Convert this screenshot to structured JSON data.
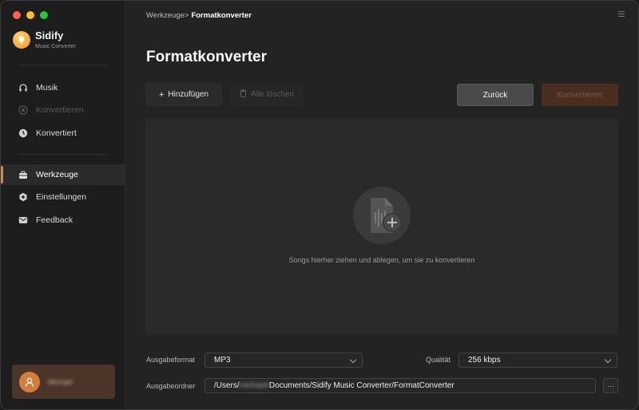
{
  "app": {
    "name": "Sidify",
    "subtitle": "Music Converter"
  },
  "sidebar": {
    "items": [
      {
        "label": "Musik",
        "icon": "headphones-icon",
        "state": "normal"
      },
      {
        "label": "Konvertieren",
        "icon": "convert-icon",
        "state": "disabled"
      },
      {
        "label": "Konvertiert",
        "icon": "clock-icon",
        "state": "normal"
      },
      {
        "label": "Werkzeuge",
        "icon": "toolbox-icon",
        "state": "active"
      },
      {
        "label": "Einstellungen",
        "icon": "gear-icon",
        "state": "normal"
      },
      {
        "label": "Feedback",
        "icon": "mail-icon",
        "state": "normal"
      }
    ],
    "user": {
      "name": "Michael",
      "icon": "user-icon"
    }
  },
  "breadcrumb": {
    "parent": "Werkzeuge",
    "separator": ">",
    "current": "Formatkonverter"
  },
  "page_title": "Formatkonverter",
  "toolbar": {
    "add_label": "Hinzufügen",
    "clear_label": "Alle löschen",
    "back_label": "Zurück",
    "convert_label": "Konvertieren"
  },
  "dropzone": {
    "text": "Songs hierher ziehen und ablegen, um sie zu konvertieren",
    "icon": "audio-file-add-icon"
  },
  "settings": {
    "format_label": "Ausgabeformat",
    "format_value": "MP3",
    "quality_label": "Qualität",
    "quality_value": "256 kbps",
    "folder_label": "Ausgabeordner",
    "folder_prefix": "/Users/",
    "folder_hidden": "michael/",
    "folder_suffix": "Documents/Sidify Music Converter/FormatConverter",
    "browse_label": "···"
  },
  "colors": {
    "accent": "#e8823a",
    "convert_button": "#4a2e20",
    "user_card": "#4a3528"
  }
}
